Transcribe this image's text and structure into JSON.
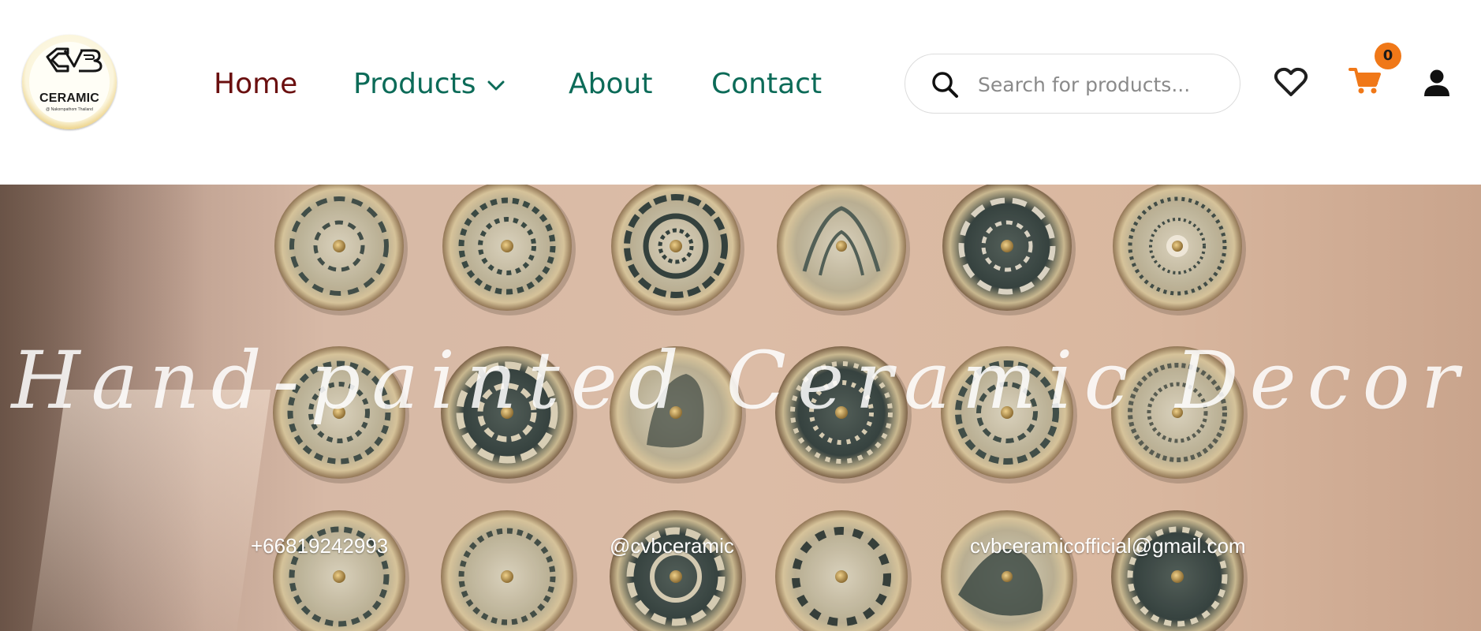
{
  "logo": {
    "text": "CERAMIC",
    "subtext": "@ Nakornpathom Thailand"
  },
  "nav": {
    "items": [
      {
        "label": "Home",
        "active": true
      },
      {
        "label": "Products",
        "has_dropdown": true
      },
      {
        "label": "About"
      },
      {
        "label": "Contact"
      }
    ]
  },
  "search": {
    "placeholder": "Search for products..."
  },
  "cart": {
    "count": "0"
  },
  "hero": {
    "tagline": "Hand-painted Ceramic Decor",
    "phone": "+66819242993",
    "social": "@cvbceramic",
    "email": "cvbceramicofficial@gmail.com"
  },
  "colors": {
    "nav_text": "#0c6b58",
    "nav_active": "#6a0f0f",
    "cart_accent": "#f07818"
  }
}
